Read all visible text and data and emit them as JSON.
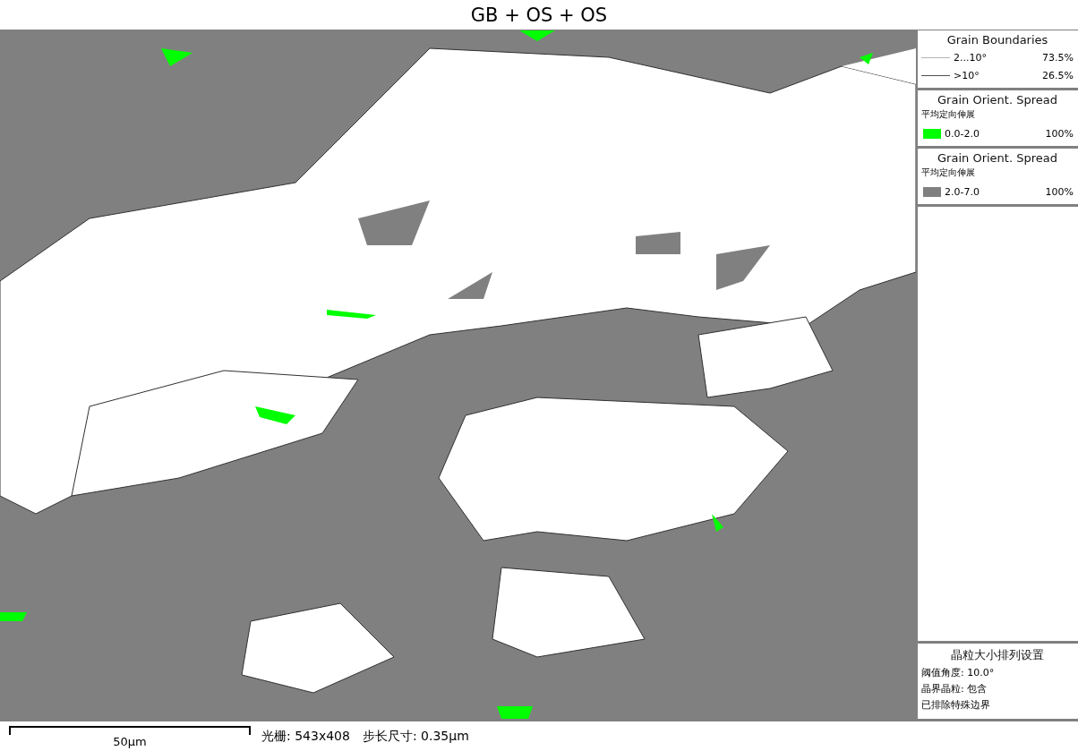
{
  "title": "GB + OS + OS",
  "legend_sections": [
    {
      "kind": "lines",
      "title": "Grain Boundaries",
      "items": [
        {
          "label": "2...10°",
          "value": "73.5%",
          "color": "#b4b4b4"
        },
        {
          "label": ">10°",
          "value": "26.5%",
          "color": "#505050"
        }
      ]
    },
    {
      "kind": "swatches",
      "title": "Grain Orient. Spread",
      "subtitle": "平均定向伸展",
      "items": [
        {
          "label": "0.0-2.0",
          "value": "100%",
          "color": "#00ff00"
        }
      ]
    },
    {
      "kind": "swatches",
      "title": "Grain Orient. Spread",
      "subtitle": "平均定向伸展",
      "items": [
        {
          "label": "2.0-7.0",
          "value": "100%",
          "color": "#808080"
        }
      ]
    }
  ],
  "settings": {
    "title": "晶粒大小排列设置",
    "lines": [
      "阈值角度: 10.0°",
      "晶界晶粒: 包含",
      "已排除特殊边界"
    ]
  },
  "scale_bar": {
    "label": "50μm"
  },
  "info": [
    "光栅: 543x408",
    "步长尺寸: 0.35μm"
  ]
}
